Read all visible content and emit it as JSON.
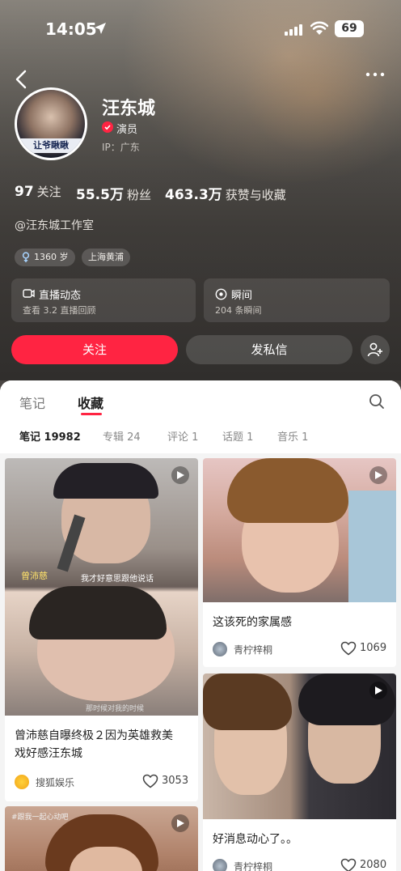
{
  "status_bar": {
    "time": "14:05",
    "battery": "69"
  },
  "profile": {
    "name": "汪东城",
    "role": "演员",
    "ip": "IP：广东",
    "avatar_caption": "让爷瞅瞅",
    "stats": [
      {
        "value": "97",
        "label": "关注"
      },
      {
        "value": "55.5万",
        "label": "粉丝"
      },
      {
        "value": "463.3万",
        "label": "获赞与收藏"
      }
    ],
    "bio": "@汪东城工作室",
    "tags": [
      {
        "icon": "female-icon",
        "text": "1360 岁"
      },
      {
        "text": "上海黄浦"
      }
    ],
    "cards": [
      {
        "title": "直播动态",
        "sub": "查看 3.2 直播回顾"
      },
      {
        "title": "瞬间",
        "sub": "204 条瞬间"
      }
    ],
    "follow_label": "关注",
    "message_label": "发私信"
  },
  "tabs": [
    {
      "label": "笔记"
    },
    {
      "label": "收藏",
      "active": true
    }
  ],
  "subtabs": [
    {
      "label": "笔记 19982",
      "active": true
    },
    {
      "label": "专辑 24"
    },
    {
      "label": "评论 1"
    },
    {
      "label": "话题 1"
    },
    {
      "label": "音乐 1"
    }
  ],
  "notes": [
    {
      "title_line1": "曾沛慈自曝终极２因为英雄救美",
      "title_line2": "戏好感汪东城",
      "author": "搜狐娱乐",
      "likes": "3053",
      "overlay_name": "曾沛慈",
      "overlay_caption": "我才好意思跟他说话",
      "overlay_caption2": "那时候对我的时候"
    },
    {
      "title_line1": "这该死的家属感",
      "author": "青柠梓桐",
      "likes": "1069"
    },
    {
      "title_line1": "好消息动心了。。",
      "author": "青柠梓桐",
      "likes": "2080"
    },
    {
      "overlay_caption": "#跟我一起心动吧"
    }
  ],
  "colors": {
    "accent": "#ff2442",
    "background": "#f4f4f4",
    "header_overlay": "#4a4643"
  }
}
